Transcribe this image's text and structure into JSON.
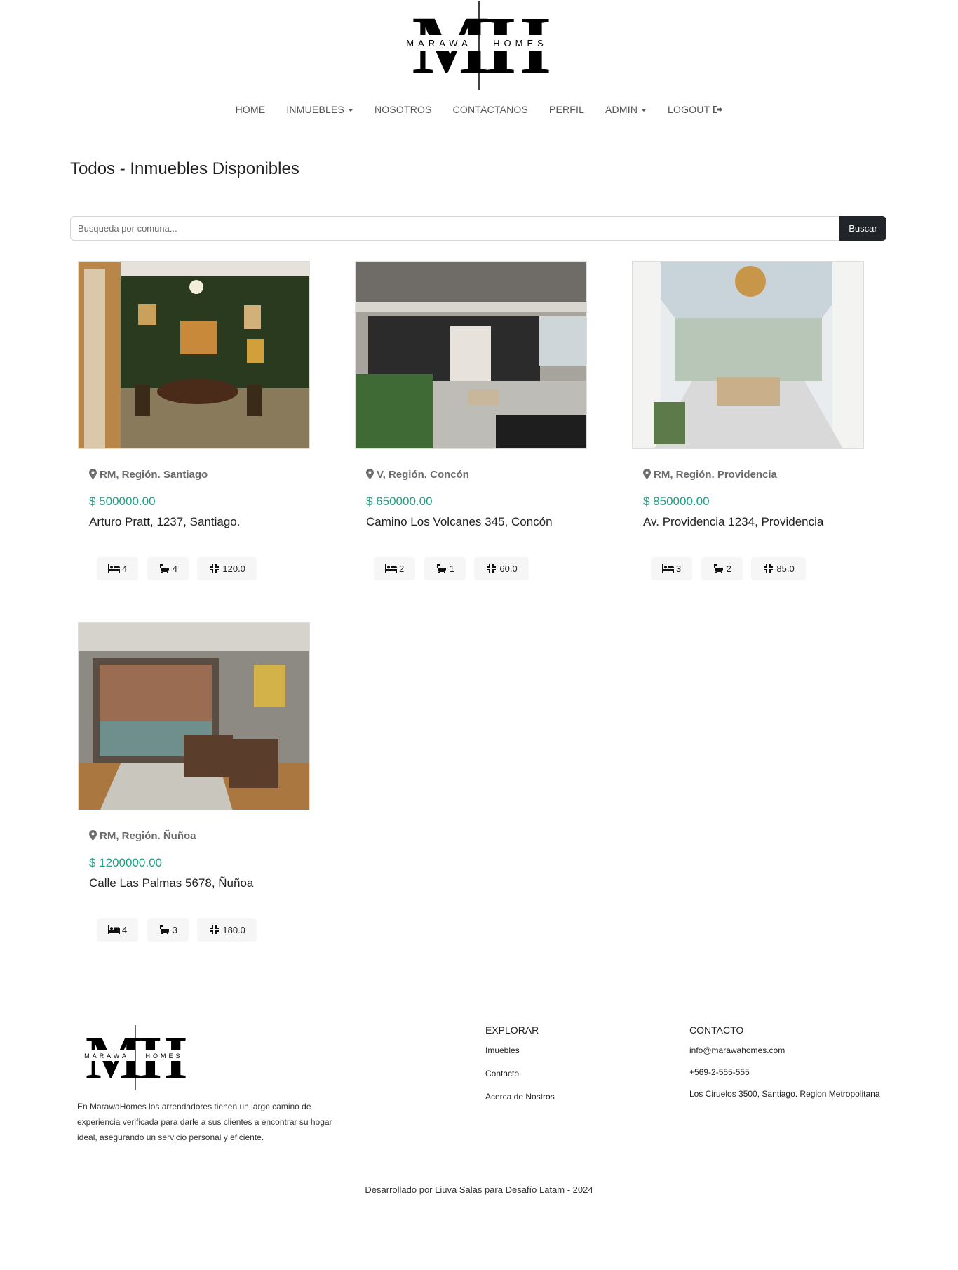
{
  "brand": {
    "monogram": "MH",
    "name_left": "MARAWA",
    "name_right": "HOMES"
  },
  "nav": {
    "items": [
      {
        "label": "HOME"
      },
      {
        "label": "INMUEBLES"
      },
      {
        "label": "NOSOTROS"
      },
      {
        "label": "CONTACTANOS"
      },
      {
        "label": "PERFIL"
      },
      {
        "label": "ADMIN"
      },
      {
        "label": "LOGOUT"
      }
    ]
  },
  "page_title": "Todos - Inmuebles Disponibles",
  "search": {
    "placeholder": "Busqueda por comuna...",
    "value": "",
    "button": "Buscar"
  },
  "listings": [
    {
      "location": "RM, Región. Santiago",
      "price": "$ 500000.00",
      "address": "Arturo Pratt, 1237, Santiago.",
      "rooms": "4",
      "baths": "4",
      "area": "120.0"
    },
    {
      "location": "V, Región. Concón",
      "price": "$ 650000.00",
      "address": "Camino Los Volcanes 345, Concón",
      "rooms": "2",
      "baths": "1",
      "area": "60.0"
    },
    {
      "location": "RM, Región. Providencia",
      "price": "$ 850000.00",
      "address": "Av. Providencia 1234, Providencia",
      "rooms": "3",
      "baths": "2",
      "area": "85.0"
    },
    {
      "location": "RM, Región. Ñuñoa",
      "price": "$ 1200000.00",
      "address": "Calle Las Palmas 5678, Ñuñoa",
      "rooms": "4",
      "baths": "3",
      "area": "180.0"
    }
  ],
  "footer": {
    "description": "En MarawaHomes los arrendadores tienen un largo camino de experiencia verificada para darle a sus clientes a encontrar su hogar ideal, asegurando un servicio personal y eficiente.",
    "explore": {
      "title": "EXPLORAR",
      "links": [
        "Imuebles",
        "Contacto",
        "Acerca de Nostros"
      ]
    },
    "contact": {
      "title": "CONTACTO",
      "email": "info@marawahomes.com",
      "phone": "+569-2-555-555",
      "address": "Los Ciruelos 3500, Santiago. Region Metropolitana"
    },
    "credit": "Desarrollado por Liuva Salas para Desafío Latam - 2024"
  },
  "colors": {
    "accent": "#1aa387",
    "button": "#212529",
    "pill_bg": "#f6f6f6"
  },
  "icons": {
    "location": "map-marker-icon",
    "rooms": "bed-icon",
    "baths": "bath-icon",
    "area": "compress-icon",
    "logout": "sign-out-icon"
  }
}
